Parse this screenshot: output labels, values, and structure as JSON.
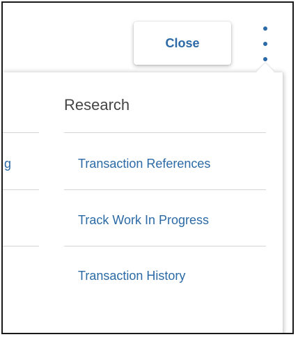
{
  "toolbar": {
    "close_label": "Close",
    "more_icon": "kebab-vertical-icon"
  },
  "menu": {
    "left_column_cut_text": "g",
    "section_title": "Research",
    "items": [
      {
        "label": "Transaction References"
      },
      {
        "label": "Track Work In Progress"
      },
      {
        "label": "Transaction History"
      }
    ]
  },
  "colors": {
    "link": "#2b6aa6",
    "heading": "#444444",
    "divider": "#d4d4d4"
  }
}
